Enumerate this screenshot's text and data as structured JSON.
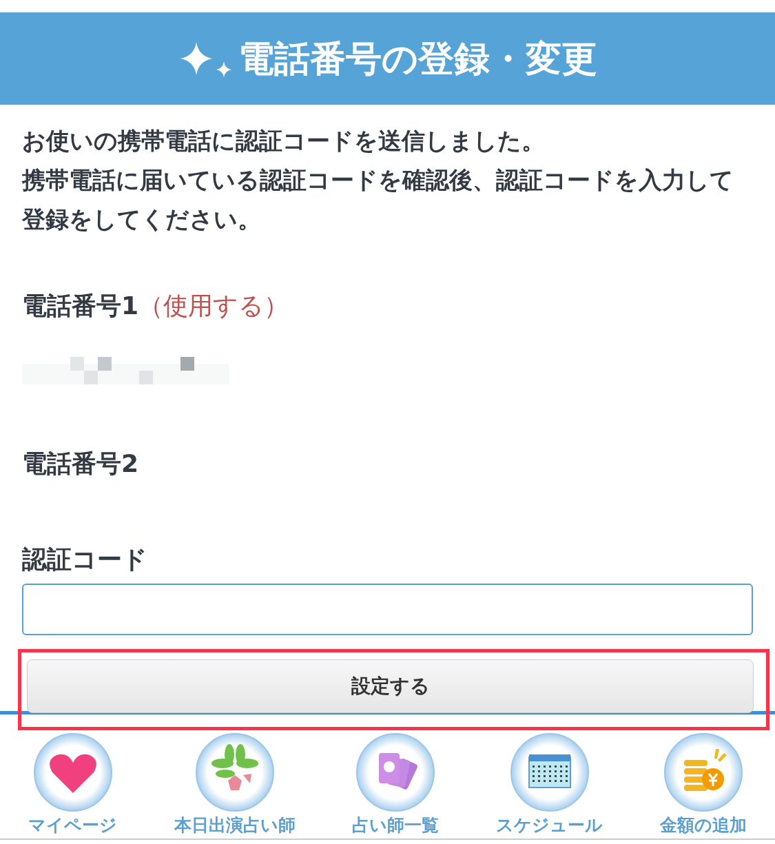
{
  "header": {
    "title": "電話番号の登録・変更"
  },
  "message": [
    "お使いの携帯電話に認証コードを送信しました。",
    "携帯電話に届いている認証コードを確認後、認証コードを入力して登録をしてください。"
  ],
  "phones": [
    {
      "label": "電話番号1",
      "note": "（使用する）",
      "redacted": true
    },
    {
      "label": "電話番号2",
      "redacted": false
    }
  ],
  "code_field": {
    "label": "認証コード"
  },
  "submit": {
    "label": "設定する",
    "highlighted": true
  },
  "nav": [
    {
      "kind": "heart",
      "label": "マイページ"
    },
    {
      "kind": "flower",
      "label": "本日出演占い師"
    },
    {
      "kind": "cards",
      "label": "占い師一覧"
    },
    {
      "kind": "calendar",
      "label": "スケジュール"
    },
    {
      "kind": "coins",
      "label": "金額の追加"
    }
  ]
}
